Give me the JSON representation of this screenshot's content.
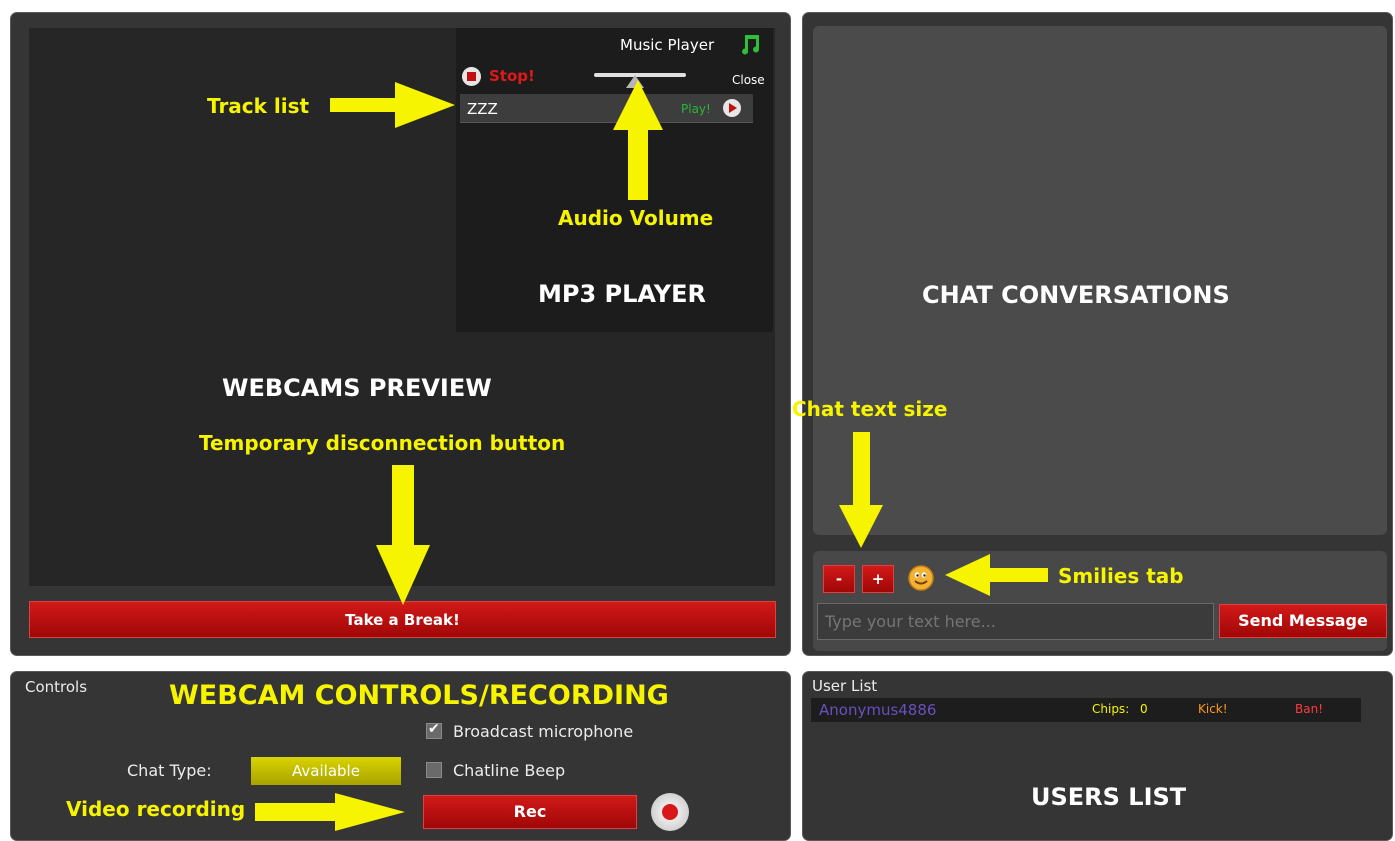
{
  "webcam_panel": {
    "preview_label": "WEBCAMS PREVIEW",
    "break_button": "Take a Break!"
  },
  "music_player": {
    "title": "Music Player",
    "stop_label": "Stop!",
    "close_label": "Close",
    "volume_level": 0.45,
    "tracks": [
      {
        "name": "ZZZ",
        "play_label": "Play!"
      }
    ],
    "section_label": "MP3 PLAYER"
  },
  "chat_panel": {
    "section_label": "CHAT CONVERSATIONS",
    "decrease_label": "-",
    "increase_label": "+",
    "input_placeholder": "Type your text here...",
    "send_button": "Send Message"
  },
  "controls_panel": {
    "title": "Controls",
    "section_label": "WEBCAM CONTROLS/RECORDING",
    "broadcast_mic_label": "Broadcast microphone",
    "broadcast_mic_checked": true,
    "chatline_beep_label": "Chatline Beep",
    "chatline_beep_checked": false,
    "chat_type_label": "Chat Type:",
    "chat_type_value": "Available",
    "rec_button": "Rec"
  },
  "users_panel": {
    "title": "User List",
    "users": [
      {
        "name": "Anonymus4886",
        "chips_label": "Chips:",
        "chips_value": "0",
        "kick_label": "Kick!",
        "ban_label": "Ban!"
      }
    ],
    "section_label": "USERS LIST"
  },
  "annotations": {
    "track_list": "Track list",
    "audio_volume": "Audio Volume",
    "temp_disconnect": "Temporary disconnection button",
    "chat_text_size": "Chat text size",
    "smilies_tab": "Smilies tab",
    "video_recording": "Video recording"
  },
  "colors": {
    "annotation": "#f7f400",
    "button_red": "#b80c0c",
    "chat_type_bg": "#c8c400",
    "user_name": "#6a4fbf"
  }
}
